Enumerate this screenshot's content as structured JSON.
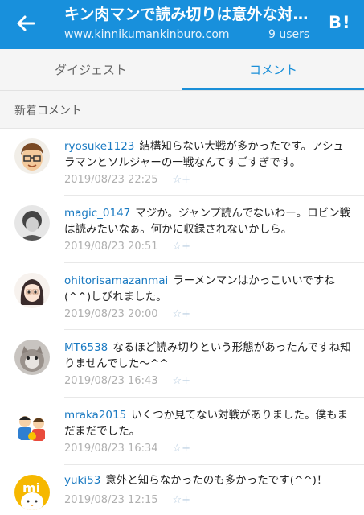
{
  "header": {
    "title": "キン肉マンで読み切りは意外な対戦が多かった",
    "url": "www.kinnikumankinburo.com",
    "users": "9 users",
    "bookmark_icon": "B!"
  },
  "tabs": [
    {
      "label": "ダイジェスト"
    },
    {
      "label": "コメント"
    }
  ],
  "section": {
    "label": "新着コメント"
  },
  "comments": [
    {
      "user": "ryosuke1123",
      "text": "結構知らない大戦が多かったです。アシュラマンとソルジャーの一戦なんてすごすぎです。",
      "date": "2019/08/23 22:25",
      "star": "☆+"
    },
    {
      "user": "magic_0147",
      "text": "マジか。ジャンプ読んでないわー。ロビン戦は読みたいなぁ。何かに収録されないかしら。",
      "date": "2019/08/23 20:51",
      "star": "☆+"
    },
    {
      "user": "ohitorisamazanmai",
      "text": "ラーメンマンはかっこいいですね(^^)しびれました。",
      "date": "2019/08/23 20:00",
      "star": "☆+"
    },
    {
      "user": "MT6538",
      "text": "なるほど読み切りという形態があったんですね知りませんでした～^^",
      "date": "2019/08/23 16:43",
      "star": "☆+"
    },
    {
      "user": "mraka2015",
      "text": "いくつか見てない対戦がありました。僕もまだまだでした。",
      "date": "2019/08/23 16:34",
      "star": "☆+"
    },
    {
      "user": "yuki53",
      "text": "意外と知らなかったのも多かったです(^^)！",
      "date": "2019/08/23 12:15",
      "star": "☆+"
    }
  ],
  "colors": {
    "accent": "#1890dc",
    "tab_active": "#1a8fd8",
    "username": "#1a7ac2"
  }
}
